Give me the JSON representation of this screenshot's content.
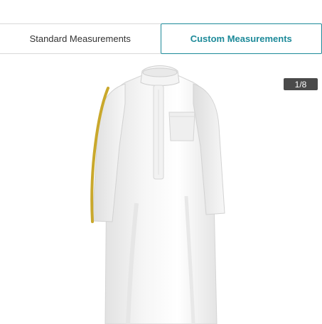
{
  "tabs": {
    "standard_label": "Standard Measurements",
    "custom_label": "Custom Measurements",
    "active": "custom"
  },
  "viewer": {
    "counter": "1/8",
    "highlight_color": "#c9a82c",
    "accent_color": "#1d8a99"
  }
}
